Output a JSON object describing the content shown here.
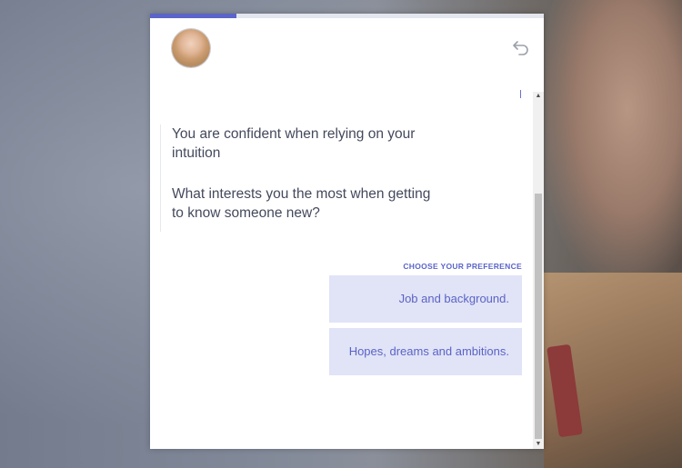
{
  "progress": {
    "value": 0.22
  },
  "header": {
    "avatar_icon": "avatar-woman-icon",
    "undo_icon": "undo-icon"
  },
  "messages": [
    "You are confident when relying on your intuition",
    "What interests you the most when getting to know someone new?"
  ],
  "preference": {
    "label": "CHOOSE YOUR PREFERENCE",
    "options": [
      "Job and background.",
      "Hopes, dreams and ambitions."
    ]
  },
  "colors": {
    "accent": "#5b64c9",
    "option_bg": "#e1e3f7",
    "text": "#44495c"
  }
}
